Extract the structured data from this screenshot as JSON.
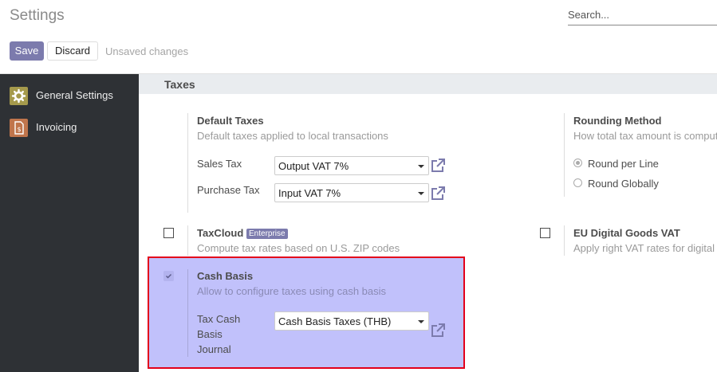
{
  "header": {
    "title": "Settings",
    "search_placeholder": "Search...",
    "save_label": "Save",
    "discard_label": "Discard",
    "unsaved_text": "Unsaved changes"
  },
  "sidebar": {
    "items": [
      {
        "label": "General Settings",
        "icon": "gear-icon",
        "color": "#a59a4c"
      },
      {
        "label": "Invoicing",
        "icon": "invoice-icon",
        "color": "#c0754c"
      }
    ]
  },
  "section": {
    "title": "Taxes"
  },
  "default_taxes": {
    "title": "Default Taxes",
    "description": "Default taxes applied to local transactions",
    "sales_tax_label": "Sales Tax",
    "sales_tax_value": "Output VAT 7%",
    "purchase_tax_label": "Purchase Tax",
    "purchase_tax_value": "Input VAT 7%"
  },
  "rounding": {
    "title": "Rounding Method",
    "description": "How total tax amount is comput",
    "options": [
      "Round per Line",
      "Round Globally"
    ],
    "selected": "Round per Line"
  },
  "taxcloud": {
    "title": "TaxCloud",
    "badge": "Enterprise",
    "description": "Compute tax rates based on U.S. ZIP codes",
    "checked": false
  },
  "eu_vat": {
    "title": "EU Digital Goods VAT",
    "description": "Apply right VAT rates for digital",
    "checked": false
  },
  "cash_basis": {
    "title": "Cash Basis",
    "description": "Allow to configure taxes using cash basis",
    "checked": true,
    "journal_label": "Tax Cash Basis Journal",
    "journal_value": "Cash Basis Taxes (THB)"
  },
  "colors": {
    "accent": "#7c7bad",
    "sidebar_bg": "#2e3135",
    "highlight_fill": "#c1c1fb",
    "highlight_border": "#e3001b"
  }
}
